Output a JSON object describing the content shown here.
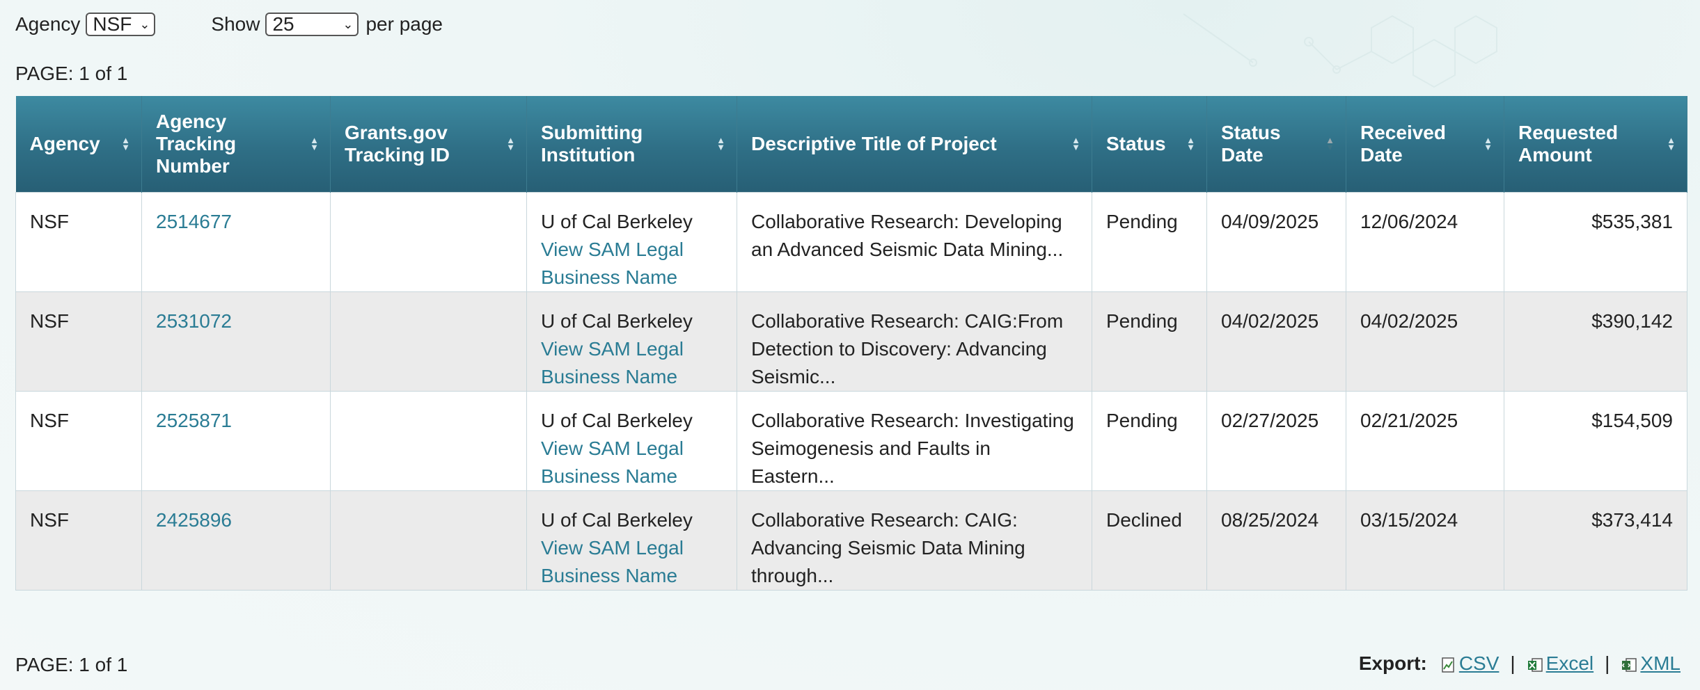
{
  "filters": {
    "agency_label": "Agency",
    "agency_value": "NSF",
    "show_label": "Show",
    "show_value": "25",
    "per_page_label": "per page"
  },
  "pagination": {
    "top": "PAGE: 1 of 1",
    "bottom": "PAGE: 1 of 1"
  },
  "table": {
    "headers": [
      "Agency",
      "Agency Tracking Number",
      "Grants.gov Tracking ID",
      "Submitting Institution",
      "Descriptive Title of Project",
      "Status",
      "Status Date",
      "Received Date",
      "Requested Amount"
    ],
    "sorted_column": "Status Date",
    "rows": [
      {
        "agency": "NSF",
        "tracking": "2514677",
        "grants_id": "",
        "institution": "U of Cal Berkeley",
        "sam_link": "View SAM Legal Business Name",
        "title": "Collaborative Research: Developing an Advanced Seismic Data Mining...",
        "status": "Pending",
        "status_date": "04/09/2025",
        "received": "12/06/2024",
        "amount": "$535,381"
      },
      {
        "agency": "NSF",
        "tracking": "2531072",
        "grants_id": "",
        "institution": "U of Cal Berkeley",
        "sam_link": "View SAM Legal Business Name",
        "title": "Collaborative Research: CAIG:From Detection to Discovery: Advancing Seismic...",
        "status": "Pending",
        "status_date": "04/02/2025",
        "received": "04/02/2025",
        "amount": "$390,142"
      },
      {
        "agency": "NSF",
        "tracking": "2525871",
        "grants_id": "",
        "institution": "U of Cal Berkeley",
        "sam_link": "View SAM Legal Business Name",
        "title": "Collaborative Research: Investigating Seimogenesis and Faults in Eastern...",
        "status": "Pending",
        "status_date": "02/27/2025",
        "received": "02/21/2025",
        "amount": "$154,509"
      },
      {
        "agency": "NSF",
        "tracking": "2425896",
        "grants_id": "",
        "institution": "U of Cal Berkeley",
        "sam_link": "View SAM Legal Business Name",
        "title": "Collaborative Research: CAIG: Advancing Seismic Data Mining through...",
        "status": "Declined",
        "status_date": "08/25/2024",
        "received": "03/15/2024",
        "amount": "$373,414"
      }
    ]
  },
  "export": {
    "label": "Export:",
    "csv": "CSV",
    "excel": "Excel",
    "xml": "XML",
    "separator": "|"
  },
  "colors": {
    "header_bg": "#2f6f86",
    "link": "#2a7c94",
    "row_alt": "#ebebeb"
  }
}
